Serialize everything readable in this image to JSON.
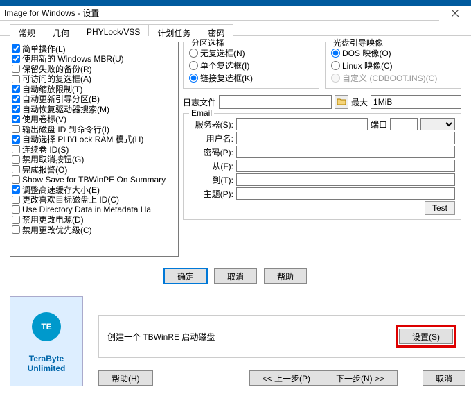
{
  "title": "Image for Windows - 设置",
  "tabs": [
    "常规",
    "几何",
    "PHYLock/VSS",
    "计划任务",
    "密码"
  ],
  "active_tab": 0,
  "checklist": [
    {
      "label": "简单操作(L)",
      "checked": true
    },
    {
      "label": "使用新的 Windows MBR(U)",
      "checked": true
    },
    {
      "label": "保留失败的备份(R)",
      "checked": false
    },
    {
      "label": "可访问的复选框(A)",
      "checked": false
    },
    {
      "label": "自动缩放限制(T)",
      "checked": true
    },
    {
      "label": "自动更新引导分区(B)",
      "checked": true
    },
    {
      "label": "自动恢复驱动器搜索(M)",
      "checked": true
    },
    {
      "label": "使用卷标(V)",
      "checked": true
    },
    {
      "label": "输出磁盘 ID 到命令行(I)",
      "checked": false
    },
    {
      "label": "自动选择 PHYLock RAM 模式(H)",
      "checked": true
    },
    {
      "label": "连续卷 ID(S)",
      "checked": false
    },
    {
      "label": "禁用取消按钮(G)",
      "checked": false
    },
    {
      "label": "完成报警(O)",
      "checked": false
    },
    {
      "label": "Show Save for TBWinPE On Summary",
      "checked": false
    },
    {
      "label": "调整高速缓存大小(E)",
      "checked": true
    },
    {
      "label": "更改喜欢目标磁盘上 ID(C)",
      "checked": false
    },
    {
      "label": "Use Directory Data in Metadata Ha",
      "checked": false
    },
    {
      "label": "禁用更改电源(D)",
      "checked": false
    },
    {
      "label": "禁用更改优先级(C)",
      "checked": false
    }
  ],
  "partition_select": {
    "title": "分区选择",
    "options": [
      {
        "label": "无复选框(N)",
        "checked": false
      },
      {
        "label": "单个复选框(I)",
        "checked": false
      },
      {
        "label": "链接复选框(K)",
        "checked": true
      }
    ]
  },
  "boot_image": {
    "title": "光盘引导映像",
    "options": [
      {
        "label": "DOS 映像(O)",
        "checked": true,
        "disabled": false
      },
      {
        "label": "Linux 映像(C)",
        "checked": false,
        "disabled": false
      },
      {
        "label": "自定义 (CDBOOT.INS)(C)",
        "checked": false,
        "disabled": true
      }
    ]
  },
  "log": {
    "label": "日志文件",
    "value": "",
    "max_label": "最大",
    "max_value": "1MiB"
  },
  "email": {
    "title": "Email",
    "server_label": "服务器(S):",
    "server": "",
    "port_label": "端口",
    "port": "",
    "user_label": "用户名:",
    "user": "",
    "pass_label": "密码(P):",
    "pass": "",
    "from_label": "从(F):",
    "from": "",
    "to_label": "到(T):",
    "to": "",
    "subject_label": "主题(P):",
    "subject": "",
    "test_label": "Test"
  },
  "dlg_buttons": {
    "ok": "确定",
    "cancel": "取消",
    "help": "帮助"
  },
  "bottom": {
    "create_label": "创建一个 TBWinRE 启动磁盘",
    "settings_label": "设置(S)",
    "help": "帮助(H)",
    "prev": "<< 上一步(P)",
    "next": "下一步(N) >>",
    "cancel": "取消"
  },
  "brand": {
    "name": "TeraByte",
    "sub": "Unlimited",
    "glyph": "TE"
  }
}
